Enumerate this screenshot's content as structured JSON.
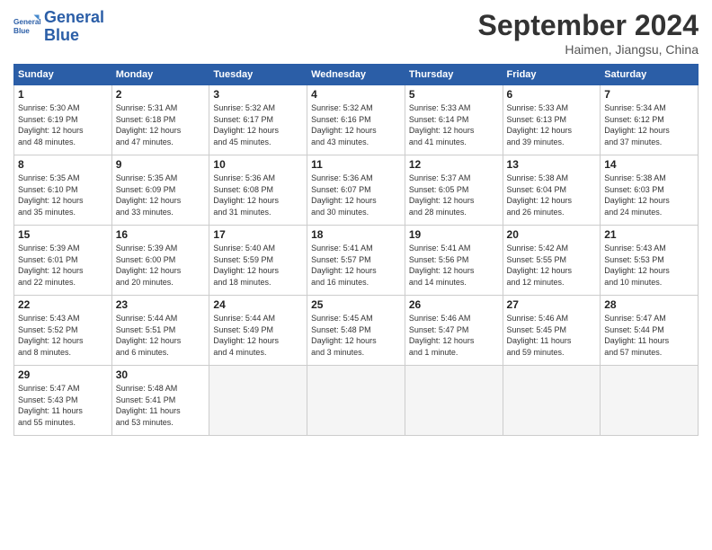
{
  "header": {
    "logo_line1": "General",
    "logo_line2": "Blue",
    "title": "September 2024",
    "location": "Haimen, Jiangsu, China"
  },
  "weekdays": [
    "Sunday",
    "Monday",
    "Tuesday",
    "Wednesday",
    "Thursday",
    "Friday",
    "Saturday"
  ],
  "weeks": [
    [
      {
        "day": "1",
        "info": "Sunrise: 5:30 AM\nSunset: 6:19 PM\nDaylight: 12 hours\nand 48 minutes."
      },
      {
        "day": "2",
        "info": "Sunrise: 5:31 AM\nSunset: 6:18 PM\nDaylight: 12 hours\nand 47 minutes."
      },
      {
        "day": "3",
        "info": "Sunrise: 5:32 AM\nSunset: 6:17 PM\nDaylight: 12 hours\nand 45 minutes."
      },
      {
        "day": "4",
        "info": "Sunrise: 5:32 AM\nSunset: 6:16 PM\nDaylight: 12 hours\nand 43 minutes."
      },
      {
        "day": "5",
        "info": "Sunrise: 5:33 AM\nSunset: 6:14 PM\nDaylight: 12 hours\nand 41 minutes."
      },
      {
        "day": "6",
        "info": "Sunrise: 5:33 AM\nSunset: 6:13 PM\nDaylight: 12 hours\nand 39 minutes."
      },
      {
        "day": "7",
        "info": "Sunrise: 5:34 AM\nSunset: 6:12 PM\nDaylight: 12 hours\nand 37 minutes."
      }
    ],
    [
      {
        "day": "8",
        "info": "Sunrise: 5:35 AM\nSunset: 6:10 PM\nDaylight: 12 hours\nand 35 minutes."
      },
      {
        "day": "9",
        "info": "Sunrise: 5:35 AM\nSunset: 6:09 PM\nDaylight: 12 hours\nand 33 minutes."
      },
      {
        "day": "10",
        "info": "Sunrise: 5:36 AM\nSunset: 6:08 PM\nDaylight: 12 hours\nand 31 minutes."
      },
      {
        "day": "11",
        "info": "Sunrise: 5:36 AM\nSunset: 6:07 PM\nDaylight: 12 hours\nand 30 minutes."
      },
      {
        "day": "12",
        "info": "Sunrise: 5:37 AM\nSunset: 6:05 PM\nDaylight: 12 hours\nand 28 minutes."
      },
      {
        "day": "13",
        "info": "Sunrise: 5:38 AM\nSunset: 6:04 PM\nDaylight: 12 hours\nand 26 minutes."
      },
      {
        "day": "14",
        "info": "Sunrise: 5:38 AM\nSunset: 6:03 PM\nDaylight: 12 hours\nand 24 minutes."
      }
    ],
    [
      {
        "day": "15",
        "info": "Sunrise: 5:39 AM\nSunset: 6:01 PM\nDaylight: 12 hours\nand 22 minutes."
      },
      {
        "day": "16",
        "info": "Sunrise: 5:39 AM\nSunset: 6:00 PM\nDaylight: 12 hours\nand 20 minutes."
      },
      {
        "day": "17",
        "info": "Sunrise: 5:40 AM\nSunset: 5:59 PM\nDaylight: 12 hours\nand 18 minutes."
      },
      {
        "day": "18",
        "info": "Sunrise: 5:41 AM\nSunset: 5:57 PM\nDaylight: 12 hours\nand 16 minutes."
      },
      {
        "day": "19",
        "info": "Sunrise: 5:41 AM\nSunset: 5:56 PM\nDaylight: 12 hours\nand 14 minutes."
      },
      {
        "day": "20",
        "info": "Sunrise: 5:42 AM\nSunset: 5:55 PM\nDaylight: 12 hours\nand 12 minutes."
      },
      {
        "day": "21",
        "info": "Sunrise: 5:43 AM\nSunset: 5:53 PM\nDaylight: 12 hours\nand 10 minutes."
      }
    ],
    [
      {
        "day": "22",
        "info": "Sunrise: 5:43 AM\nSunset: 5:52 PM\nDaylight: 12 hours\nand 8 minutes."
      },
      {
        "day": "23",
        "info": "Sunrise: 5:44 AM\nSunset: 5:51 PM\nDaylight: 12 hours\nand 6 minutes."
      },
      {
        "day": "24",
        "info": "Sunrise: 5:44 AM\nSunset: 5:49 PM\nDaylight: 12 hours\nand 4 minutes."
      },
      {
        "day": "25",
        "info": "Sunrise: 5:45 AM\nSunset: 5:48 PM\nDaylight: 12 hours\nand 3 minutes."
      },
      {
        "day": "26",
        "info": "Sunrise: 5:46 AM\nSunset: 5:47 PM\nDaylight: 12 hours\nand 1 minute."
      },
      {
        "day": "27",
        "info": "Sunrise: 5:46 AM\nSunset: 5:45 PM\nDaylight: 11 hours\nand 59 minutes."
      },
      {
        "day": "28",
        "info": "Sunrise: 5:47 AM\nSunset: 5:44 PM\nDaylight: 11 hours\nand 57 minutes."
      }
    ],
    [
      {
        "day": "29",
        "info": "Sunrise: 5:47 AM\nSunset: 5:43 PM\nDaylight: 11 hours\nand 55 minutes."
      },
      {
        "day": "30",
        "info": "Sunrise: 5:48 AM\nSunset: 5:41 PM\nDaylight: 11 hours\nand 53 minutes."
      },
      {
        "day": "",
        "info": ""
      },
      {
        "day": "",
        "info": ""
      },
      {
        "day": "",
        "info": ""
      },
      {
        "day": "",
        "info": ""
      },
      {
        "day": "",
        "info": ""
      }
    ]
  ]
}
